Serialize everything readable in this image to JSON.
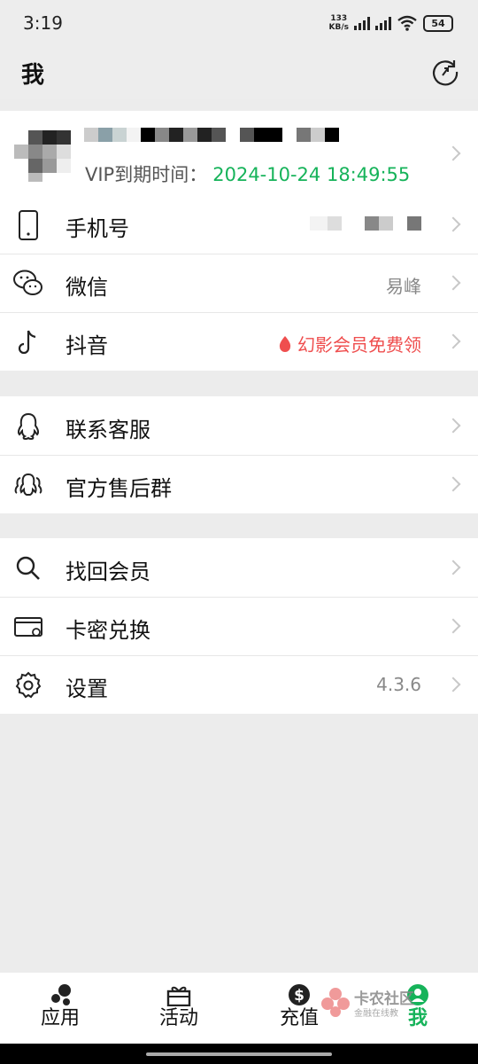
{
  "status_bar": {
    "time": "3:19",
    "speed_value": "133",
    "speed_unit": "KB/s",
    "battery": "54"
  },
  "header": {
    "title": "我"
  },
  "profile": {
    "vip_label": "VIP到期时间：",
    "vip_date": "2024-10-24 18:49:55"
  },
  "group1": [
    {
      "label": "手机号",
      "value": ""
    },
    {
      "label": "微信",
      "value": "易峰"
    },
    {
      "label": "抖音",
      "value": "幻影会员免费领"
    }
  ],
  "group2": [
    {
      "label": "联系客服"
    },
    {
      "label": "官方售后群"
    }
  ],
  "group3": [
    {
      "label": "找回会员",
      "value": ""
    },
    {
      "label": "卡密兑换",
      "value": ""
    },
    {
      "label": "设置",
      "value": "4.3.6"
    }
  ],
  "tabbar": [
    {
      "label": "应用"
    },
    {
      "label": "活动"
    },
    {
      "label": "充值"
    },
    {
      "label": "我"
    }
  ],
  "watermark": {
    "line1": "卡农社区",
    "line2": "金融在线教"
  },
  "colors": {
    "accent": "#16b35a",
    "promo": "#ef4e4e",
    "background": "#ececec"
  }
}
